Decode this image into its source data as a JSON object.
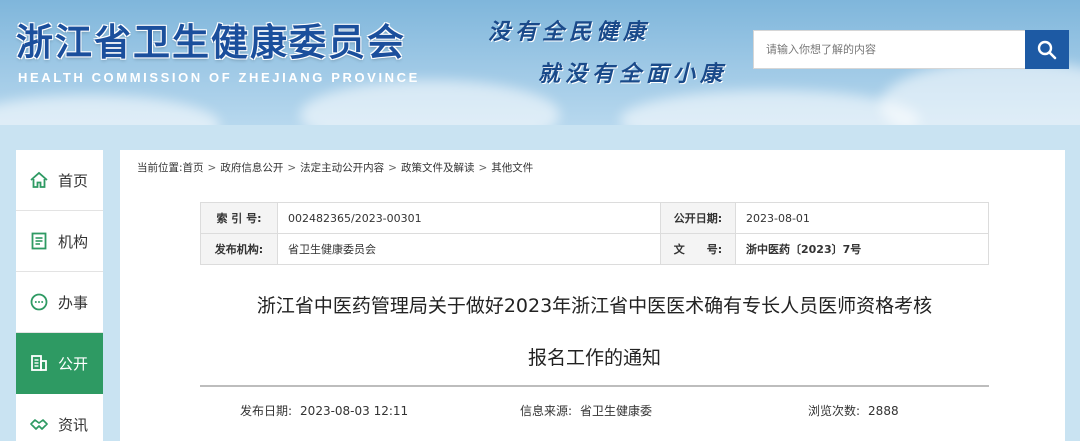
{
  "header": {
    "title": "浙江省卫生健康委员会",
    "subtitle": "HEALTH COMMISSION OF ZHEJIANG PROVINCE",
    "slogan_line1": "没有全民健康",
    "slogan_line2": "就没有全面小康",
    "search_placeholder": "请输入你想了解的内容",
    "search_icon": "search-icon"
  },
  "sidebar": {
    "items": [
      {
        "label": "首页",
        "icon": "home-icon",
        "active": false
      },
      {
        "label": "机构",
        "icon": "document-icon",
        "active": false
      },
      {
        "label": "办事",
        "icon": "chat-icon",
        "active": false
      },
      {
        "label": "公开",
        "icon": "building-icon",
        "active": true
      },
      {
        "label": "资讯",
        "icon": "handshake-icon",
        "active": false
      }
    ],
    "active_color": "#2e9a63"
  },
  "breadcrumb": {
    "prefix": "当前位置:",
    "items": [
      "首页",
      "政府信息公开",
      "法定主动公开内容",
      "政策文件及解读",
      "其他文件"
    ]
  },
  "meta": {
    "index_label": "索 引 号:",
    "index_value": "002482365/2023-00301",
    "open_date_label": "公开日期:",
    "open_date_value": "2023-08-01",
    "publisher_label": "发布机构:",
    "publisher_value": "省卫生健康委员会",
    "doc_no_label": "文　　号:",
    "doc_no_value": "浙中医药〔2023〕7号"
  },
  "document": {
    "title_line1": "浙江省中医药管理局关于做好2023年浙江省中医医术确有专长人员医师资格考核",
    "title_line2": "报名工作的通知",
    "publish_date_label": "发布日期:",
    "publish_date_value": "2023-08-03 12:11",
    "source_label": "信息来源:",
    "source_value": "省卫生健康委",
    "views_label": "浏览次数:",
    "views_value": "2888"
  },
  "colors": {
    "brand_blue": "#1d5aa4",
    "title_blue": "#1b4f9c"
  }
}
